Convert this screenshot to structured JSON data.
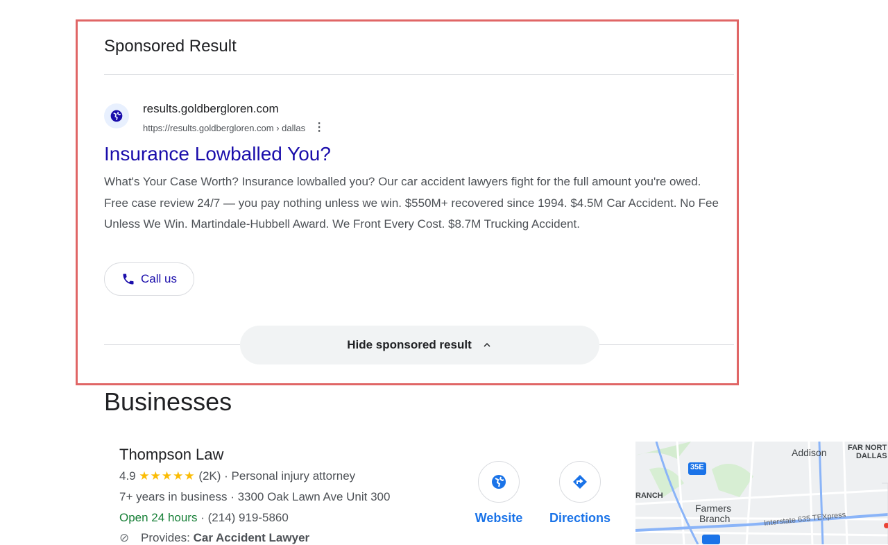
{
  "sponsored": {
    "header": "Sponsored Result",
    "site_name": "results.goldbergloren.com",
    "site_url": "https://results.goldbergloren.com › dallas",
    "ad_title": "Insurance Lowballed You?",
    "description": "What's Your Case Worth? Insurance lowballed you? Our car accident lawyers fight for the full amount you're owed. Free case review 24/7 — you pay nothing unless we win. $550M+ recovered since 1994. $4.5M Car Accident. No Fee Unless We Win. Martindale-Hubbell Award. We Front Every Cost. $8.7M Trucking Accident.",
    "call_label": "Call us",
    "hide_label": "Hide sponsored result"
  },
  "businesses": {
    "title": "Businesses",
    "items": [
      {
        "name": "Thompson Law",
        "rating": "4.9",
        "stars": "★★★★★",
        "reviews": "(2K)",
        "category": "· Personal injury attorney",
        "years": "7+ years in business",
        "address": "· 3300 Oak Lawn Ave Unit 300",
        "hours": "Open 24 hours",
        "phone": "· (214) 919-5860",
        "provides_label": "Provides:",
        "provides_value": "Car Accident Lawyer"
      }
    ],
    "actions": {
      "website_label": "Website",
      "directions_label": "Directions"
    }
  },
  "map": {
    "labels": {
      "addison": "Addison",
      "far_north_dallas_1": "FAR NORT",
      "far_north_dallas_2": "DALLAS",
      "ranch": "RANCH",
      "farmers_branch_1": "Farmers",
      "farmers_branch_2": "Branch",
      "highway_35e": "35E",
      "interstate_635": "Interstate 635 TEXpress"
    }
  },
  "colors": {
    "highlight_border": "#e06666",
    "link": "#1a0dab",
    "action_blue": "#1a73e8",
    "stars": "#fbbc04",
    "open_green": "#188038"
  }
}
